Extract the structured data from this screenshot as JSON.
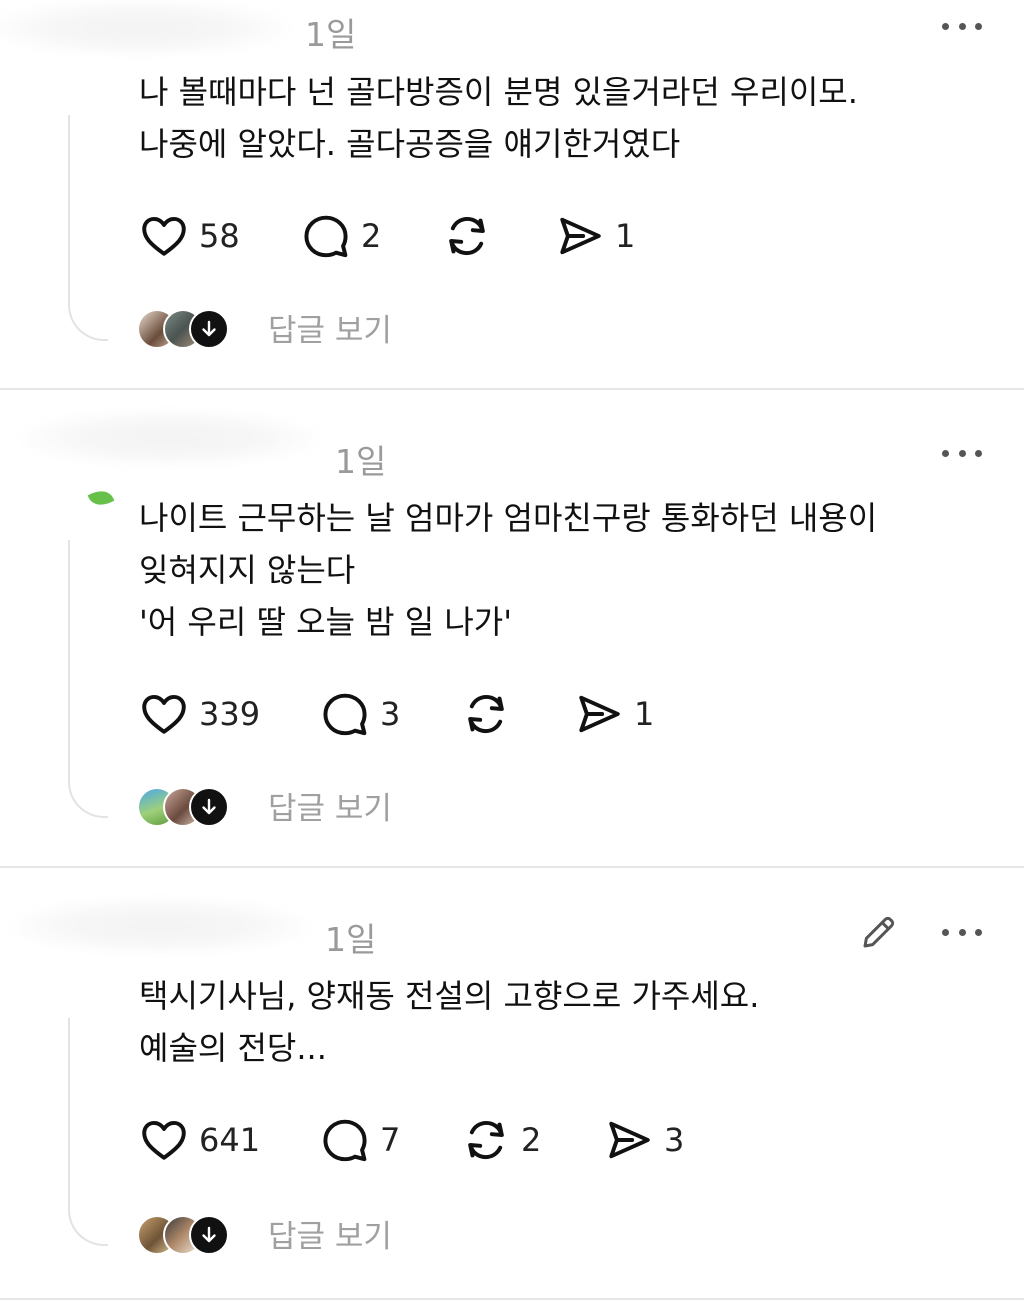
{
  "posts": [
    {
      "time": "1일",
      "text": "나 볼때마다 넌 골다방증이 분명 있을거라던 우리이모.\n나중에 알았다. 골다공증을 얘기한거였다",
      "likes": "58",
      "comments": "2",
      "reposts": "",
      "shares": "1",
      "reply_label": "답글 보기",
      "editable": false
    },
    {
      "time": "1일",
      "text": "나이트 근무하는  날  엄마가  엄마친구랑  통화하던 내용이\n잊혀지지  않는다\n'어  우리  딸  오늘  밤  일  나가'",
      "likes": "339",
      "comments": "3",
      "reposts": "",
      "shares": "1",
      "reply_label": "답글 보기",
      "editable": false
    },
    {
      "time": "1일",
      "text": "택시기사님, 양재동 전설의 고향으로 가주세요.\n예술의 전당...",
      "likes": "641",
      "comments": "7",
      "reposts": "2",
      "shares": "3",
      "reply_label": "답글 보기",
      "editable": true
    }
  ],
  "icons": {
    "like": "heart-icon",
    "comment": "comment-bubble-icon",
    "repost": "repost-icon",
    "share": "send-icon",
    "more": "more-dots-icon",
    "edit": "pencil-icon",
    "replies_more": "arrow-down-icon"
  },
  "colors": {
    "text": "#111111",
    "muted": "#9a9a9a",
    "divider": "#e6e6e6"
  }
}
